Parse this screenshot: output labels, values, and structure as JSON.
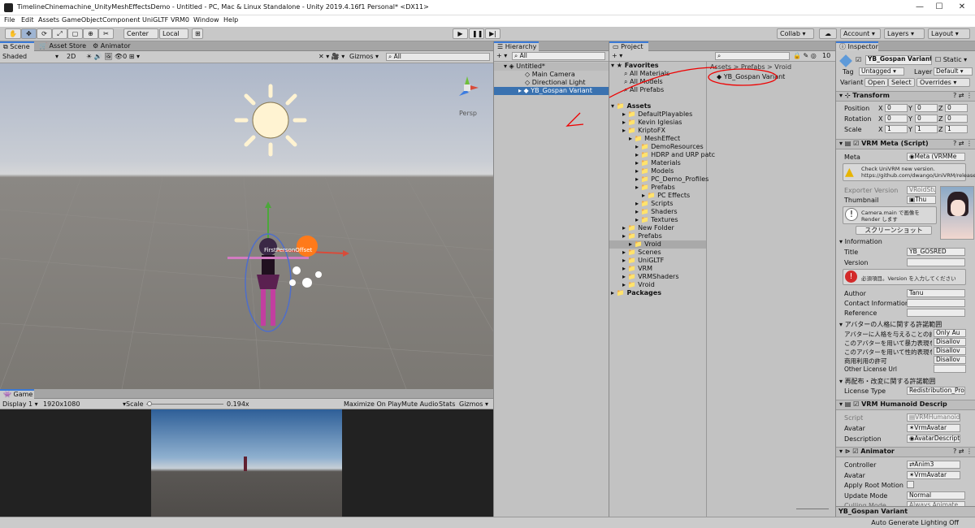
{
  "window": {
    "title": "TimelineChinemachine_UnityMeshEffectsDemo - Untitled - PC, Mac & Linux Standalone - Unity 2019.4.16f1 Personal* <DX11>",
    "min": "—",
    "max": "☐",
    "close": "✕"
  },
  "menu": [
    "File",
    "Edit",
    "Assets",
    "GameObject",
    "Component",
    "UniGLTF",
    "VRM0",
    "Window",
    "Help"
  ],
  "toolbar": {
    "center": "Center",
    "local": "Local",
    "collab": "Collab ▾",
    "account": "Account",
    "layers": "Layers",
    "layout": "Layout"
  },
  "scene": {
    "tabs": [
      "Scene",
      "Asset Store",
      "Animator"
    ],
    "shading": "Shaded",
    "mode2d": "2D",
    "gizmos": "Gizmos",
    "search": "All",
    "persp": "Persp",
    "cam_label": "FirstPersonOffset"
  },
  "game": {
    "tab": "Game",
    "display": "Display 1",
    "resolution": "1920x1080",
    "scale_label": "Scale",
    "scale_value": "0.194x",
    "maximize": "Maximize On Play",
    "mute": "Mute Audio",
    "stats": "Stats",
    "gizmos": "Gizmos"
  },
  "hierarchy": {
    "tab": "Hierarchy",
    "search": "All",
    "root": "Untitled*",
    "items": [
      "Main Camera",
      "Directional Light",
      "YB_Gospan Variant"
    ]
  },
  "project": {
    "tab": "Project",
    "favorites": {
      "label": "Favorites",
      "items": [
        "All Materials",
        "All Models",
        "All Prefabs"
      ]
    },
    "assets_label": "Assets",
    "tree": [
      {
        "label": "DefaultPlayables",
        "indent": 1
      },
      {
        "label": "Kevin Iglesias",
        "indent": 1
      },
      {
        "label": "KriptoFX",
        "indent": 1
      },
      {
        "label": "MeshEffect",
        "indent": 2
      },
      {
        "label": "DemoResources",
        "indent": 3
      },
      {
        "label": "HDRP and URP patc",
        "indent": 3
      },
      {
        "label": "Materials",
        "indent": 3
      },
      {
        "label": "Models",
        "indent": 3
      },
      {
        "label": "PC_Demo_Profiles",
        "indent": 3
      },
      {
        "label": "Prefabs",
        "indent": 3
      },
      {
        "label": "PC Effects",
        "indent": 4
      },
      {
        "label": "Scripts",
        "indent": 3
      },
      {
        "label": "Shaders",
        "indent": 3
      },
      {
        "label": "Textures",
        "indent": 3
      },
      {
        "label": "New Folder",
        "indent": 1
      },
      {
        "label": "Prefabs",
        "indent": 1
      },
      {
        "label": "Vroid",
        "indent": 2
      },
      {
        "label": "Scenes",
        "indent": 1
      },
      {
        "label": "UniGLTF",
        "indent": 1
      },
      {
        "label": "VRM",
        "indent": 1
      },
      {
        "label": "VRMShaders",
        "indent": 1
      },
      {
        "label": "Vroid",
        "indent": 1
      }
    ],
    "packages_label": "Packages",
    "breadcrumb": "Assets > Prefabs > Vroid",
    "file": "YB_Gospan Variant",
    "count": "10"
  },
  "inspector": {
    "tab": "Inspector",
    "object_name": "YB_Gospan Variant",
    "static": "Static",
    "tag_label": "Tag",
    "tag": "Untagged",
    "layer_label": "Layer",
    "layer": "Default",
    "variant": "Variant",
    "open": "Open",
    "select": "Select",
    "overrides": "Overrides",
    "transform": {
      "title": "Transform",
      "rows": [
        {
          "label": "Position",
          "x": "0",
          "y": "0",
          "z": "0"
        },
        {
          "label": "Rotation",
          "x": "0",
          "y": "0",
          "z": "0"
        },
        {
          "label": "Scale",
          "x": "1",
          "y": "1",
          "z": "1"
        }
      ]
    },
    "vrm_meta": {
      "title": "VRM Meta (Script)",
      "meta_label": "Meta",
      "meta_value": "Meta (VRMMe",
      "warning": "Check UniVRM new version. https://github.com/dwango/UniVRM/releases",
      "exporter_label": "Exporter Version",
      "exporter_value": "VRoidStu",
      "thumbnail_label": "Thumbnail",
      "thumbnail_value": "Thu",
      "camera_note": "Camera.main で画像を Render します",
      "screenshot_button": "スクリーンショット",
      "info_label": "Information",
      "title_label": "Title",
      "title_value": "YB_GOSRED",
      "version_label": "Version",
      "version_value": "",
      "version_error": "必須項目。Version を入力してください",
      "author_label": "Author",
      "author_value": "Tanu",
      "contact_label": "Contact Information",
      "contact_value": "",
      "reference_label": "Reference",
      "reference_value": "",
      "perm_header": "アバターの人格に関する許諾範囲",
      "perm_rows": [
        {
          "label": "アバターに人格を与えることの許",
          "value": "Only Au"
        },
        {
          "label": "このアバターを用いて暴力表現を",
          "value": "Disallov"
        },
        {
          "label": "このアバターを用いて性的表現を",
          "value": "Disallov"
        },
        {
          "label": "商用利用の許可",
          "value": "Disallov"
        },
        {
          "label": "Other License Url",
          "value": ""
        }
      ],
      "redist_header": "再配布・改変に関する許諾範囲",
      "license_label": "License Type",
      "license_value": "Redistribution_Pro"
    },
    "humanoid": {
      "title": "VRM Humanoid Descrip",
      "script_label": "Script",
      "script_value": "VRMHumanoid",
      "avatar_label": "Avatar",
      "avatar_value": "VrmAvatar",
      "desc_label": "Description",
      "desc_value": "AvatarDescript"
    },
    "animator": {
      "title": "Animator",
      "controller_label": "Controller",
      "controller_value": "Anim3",
      "avatar_label": "Avatar",
      "avatar_value": "VrmAvatar",
      "root_motion_label": "Apply Root Motion",
      "update_label": "Update Mode",
      "update_value": "Normal",
      "culling_label": "Culling Mode",
      "culling_value": "Always Animate"
    },
    "footer": "YB_Gospan Variant"
  },
  "status": {
    "text": "Auto Generate Lighting Off"
  }
}
